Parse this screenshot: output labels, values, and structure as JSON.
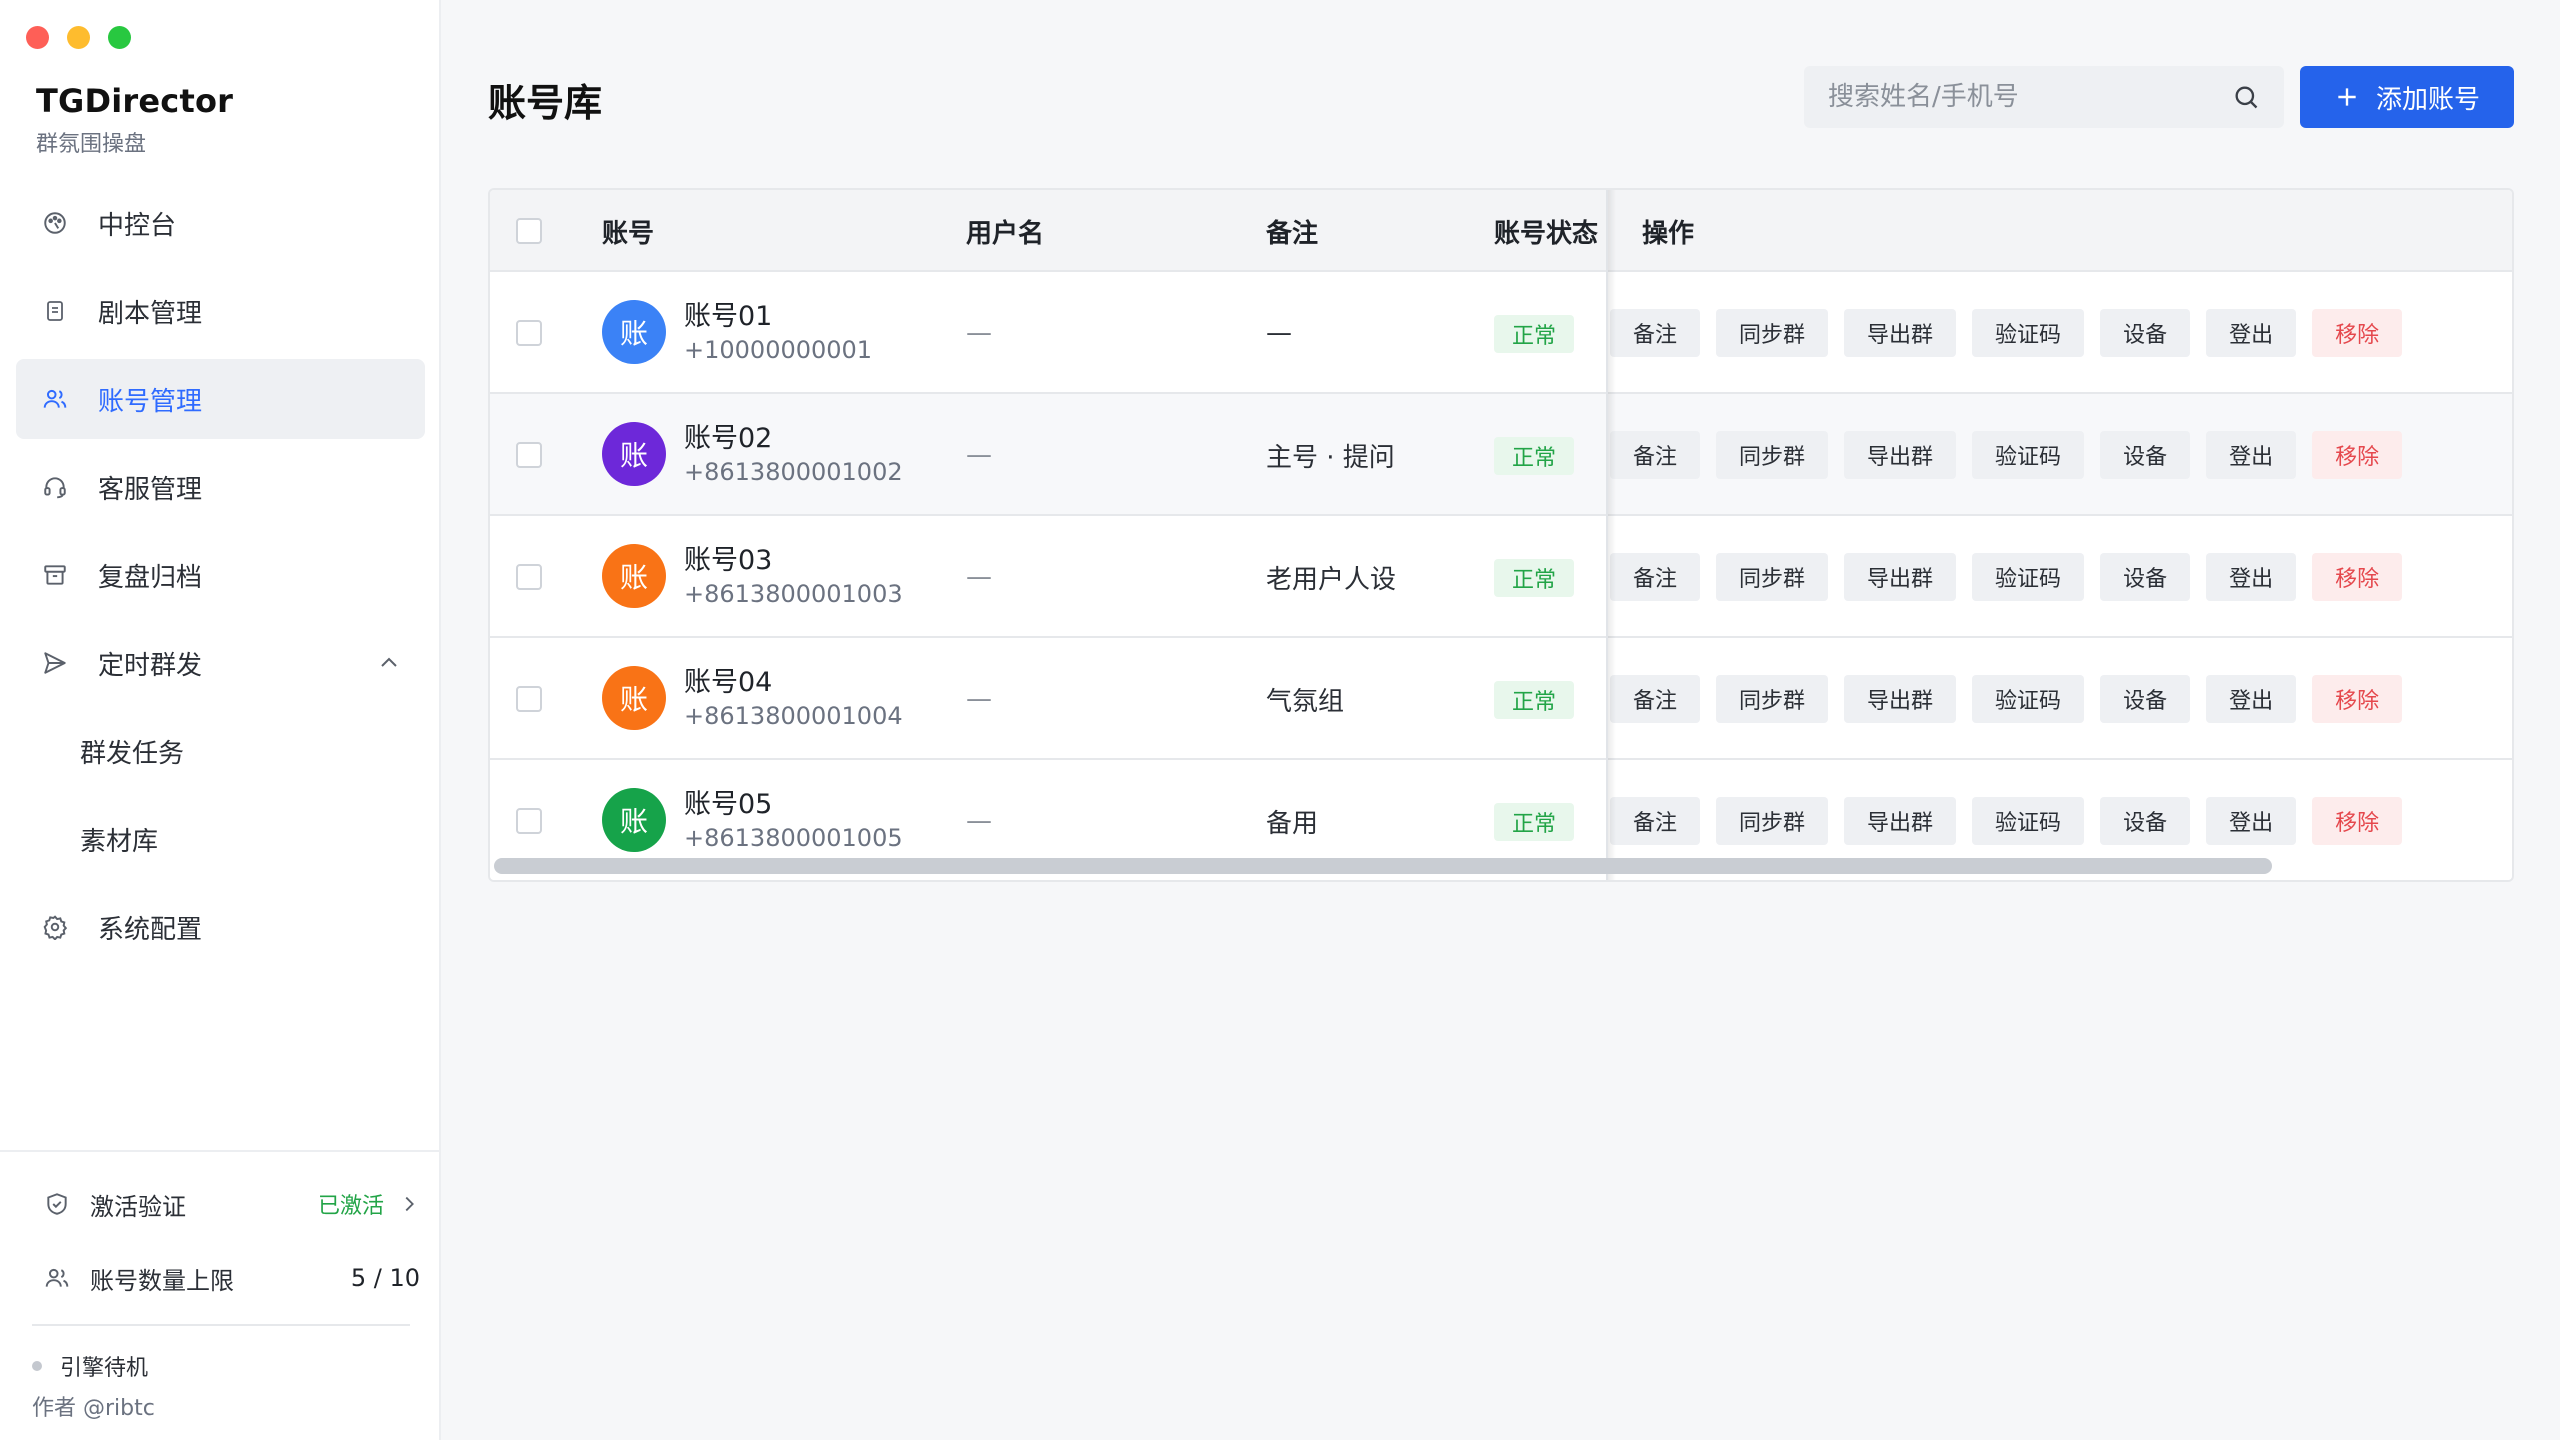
{
  "window": {
    "controls": [
      "close",
      "minimize",
      "zoom"
    ]
  },
  "brand": {
    "title": "TGDirector",
    "subtitle": "群氛围操盘"
  },
  "sidebar": {
    "items": [
      {
        "label": "中控台",
        "icon": "dashboard-icon"
      },
      {
        "label": "剧本管理",
        "icon": "document-icon"
      },
      {
        "label": "账号管理",
        "icon": "users-icon",
        "active": true
      },
      {
        "label": "客服管理",
        "icon": "headset-icon"
      },
      {
        "label": "复盘归档",
        "icon": "archive-icon"
      },
      {
        "label": "定时群发",
        "icon": "send-icon",
        "expanded": true
      },
      {
        "label": "群发任务",
        "sub": true
      },
      {
        "label": "素材库",
        "sub": true
      },
      {
        "label": "系统配置",
        "icon": "gear-icon"
      }
    ],
    "activation": {
      "label": "激活验证",
      "status": "已激活"
    },
    "quota": {
      "label": "账号数量上限",
      "value": "5 / 10"
    },
    "engine": "引擎待机",
    "author": "作者 @ribtc"
  },
  "header": {
    "title": "账号库",
    "search_placeholder": "搜索姓名/手机号",
    "add_button": "添加账号"
  },
  "table": {
    "columns": {
      "account": "账号",
      "username": "用户名",
      "note": "备注",
      "status": "账号状态",
      "actions": "操作"
    },
    "actions": [
      "备注",
      "同步群",
      "导出群",
      "验证码",
      "设备",
      "登出",
      "移除"
    ],
    "rows": [
      {
        "avatar": "账",
        "avatar_color": "#3b82f6",
        "name": "账号01",
        "phone": "+10000000001",
        "username": "—",
        "note": "—",
        "status": "正常"
      },
      {
        "avatar": "账",
        "avatar_color": "#6d28d9",
        "name": "账号02",
        "phone": "+8613800001002",
        "username": "—",
        "note": "主号 · 提问",
        "status": "正常"
      },
      {
        "avatar": "账",
        "avatar_color": "#f97316",
        "name": "账号03",
        "phone": "+8613800001003",
        "username": "—",
        "note": "老用户人设",
        "status": "正常"
      },
      {
        "avatar": "账",
        "avatar_color": "#f97316",
        "name": "账号04",
        "phone": "+8613800001004",
        "username": "—",
        "note": "气氛组",
        "status": "正常"
      },
      {
        "avatar": "账",
        "avatar_color": "#16a34a",
        "name": "账号05",
        "phone": "+8613800001005",
        "username": "—",
        "note": "备用",
        "status": "正常"
      }
    ]
  },
  "colors": {
    "accent": "#2563eb",
    "success": "#22a447",
    "danger": "#e5484d"
  }
}
